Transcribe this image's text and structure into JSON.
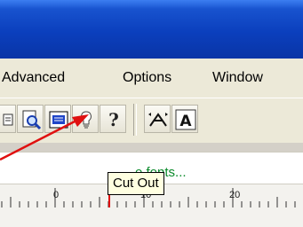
{
  "menu": {
    "advanced": "Advanced",
    "options": "Options",
    "window": "Window"
  },
  "toolbar": {
    "buttons": [
      {
        "icon": "print-icon"
      },
      {
        "icon": "print-preview-icon"
      },
      {
        "icon": "cut-out-icon"
      },
      {
        "icon": "lightbulb-icon"
      },
      {
        "icon": "help-icon"
      },
      {
        "icon": "stretch-icon"
      },
      {
        "icon": "text-a-icon"
      }
    ]
  },
  "hint_text": "e fonts...",
  "tooltip": "Cut Out",
  "ruler": {
    "marks": [
      "0",
      "10",
      "20"
    ]
  },
  "colors": {
    "title_bar": "#0b3fbd",
    "tooltip_bg": "#ffffe1",
    "hint_text": "#0a8a2a",
    "arrow": "#e01010"
  }
}
